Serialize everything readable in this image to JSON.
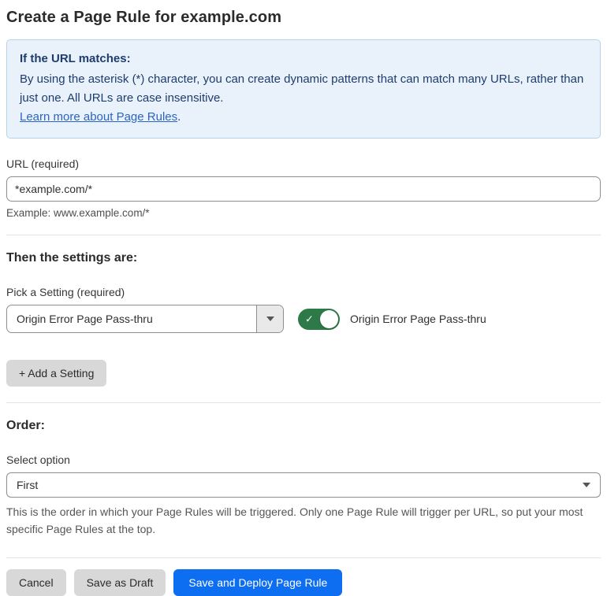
{
  "page": {
    "title": "Create a Page Rule for example.com"
  },
  "info_box": {
    "heading": "If the URL matches:",
    "body": "By using the asterisk (*) character, you can create dynamic patterns that can match many URLs, rather than just one. All URLs are case insensitive.",
    "link_text": "Learn more about Page Rules",
    "link_suffix": "."
  },
  "url_field": {
    "label": "URL (required)",
    "value": "*example.com/*",
    "helper": "Example: www.example.com/*"
  },
  "settings_section": {
    "heading": "Then the settings are:",
    "setting_label": "Pick a Setting (required)",
    "setting_value": "Origin Error Page Pass-thru",
    "toggle_state": "on",
    "toggle_label": "Origin Error Page Pass-thru",
    "add_setting_button": "+ Add a Setting"
  },
  "order_section": {
    "heading": "Order:",
    "select_label": "Select option",
    "select_value": "First",
    "helper": "This is the order in which your Page Rules will be triggered. Only one Page Rule will trigger per URL, so put your most specific Page Rules at the top."
  },
  "footer": {
    "cancel_button": "Cancel",
    "save_draft_button": "Save as Draft",
    "save_deploy_button": "Save and Deploy Page Rule"
  },
  "icons": {
    "toggle_check": "✓"
  },
  "colors": {
    "info_bg": "#e9f2fb",
    "info_border": "#b5d3ef",
    "info_text": "#1e3c6e",
    "link": "#2a64c5",
    "toggle_on": "#2d7a48",
    "primary_button": "#0d6ef2",
    "secondary_button": "#d8d8d8"
  }
}
